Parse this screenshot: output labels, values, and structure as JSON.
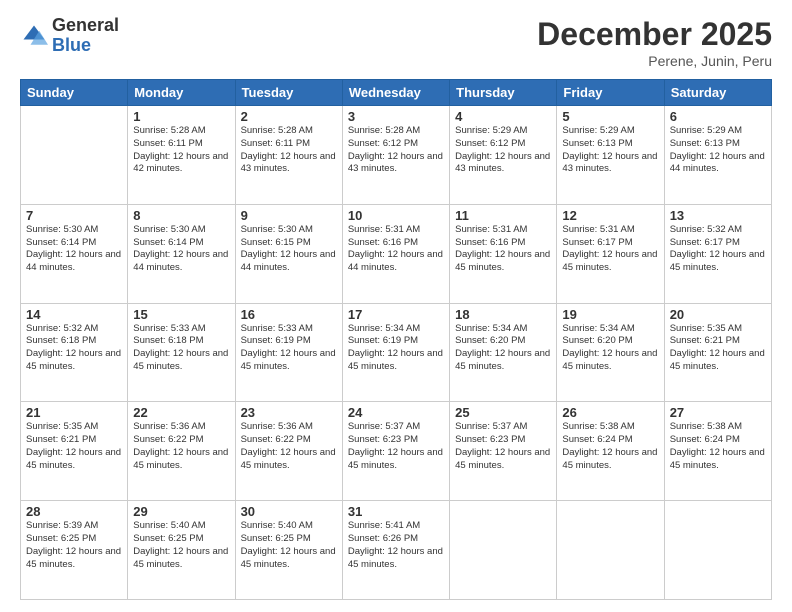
{
  "logo": {
    "general": "General",
    "blue": "Blue"
  },
  "title": "December 2025",
  "location": "Perene, Junin, Peru",
  "days_header": [
    "Sunday",
    "Monday",
    "Tuesday",
    "Wednesday",
    "Thursday",
    "Friday",
    "Saturday"
  ],
  "weeks": [
    [
      {
        "day": "",
        "info": ""
      },
      {
        "day": "1",
        "info": "Sunrise: 5:28 AM\nSunset: 6:11 PM\nDaylight: 12 hours and 42 minutes."
      },
      {
        "day": "2",
        "info": "Sunrise: 5:28 AM\nSunset: 6:11 PM\nDaylight: 12 hours and 43 minutes."
      },
      {
        "day": "3",
        "info": "Sunrise: 5:28 AM\nSunset: 6:12 PM\nDaylight: 12 hours and 43 minutes."
      },
      {
        "day": "4",
        "info": "Sunrise: 5:29 AM\nSunset: 6:12 PM\nDaylight: 12 hours and 43 minutes."
      },
      {
        "day": "5",
        "info": "Sunrise: 5:29 AM\nSunset: 6:13 PM\nDaylight: 12 hours and 43 minutes."
      },
      {
        "day": "6",
        "info": "Sunrise: 5:29 AM\nSunset: 6:13 PM\nDaylight: 12 hours and 44 minutes."
      }
    ],
    [
      {
        "day": "7",
        "info": "Sunrise: 5:30 AM\nSunset: 6:14 PM\nDaylight: 12 hours and 44 minutes."
      },
      {
        "day": "8",
        "info": "Sunrise: 5:30 AM\nSunset: 6:14 PM\nDaylight: 12 hours and 44 minutes."
      },
      {
        "day": "9",
        "info": "Sunrise: 5:30 AM\nSunset: 6:15 PM\nDaylight: 12 hours and 44 minutes."
      },
      {
        "day": "10",
        "info": "Sunrise: 5:31 AM\nSunset: 6:16 PM\nDaylight: 12 hours and 44 minutes."
      },
      {
        "day": "11",
        "info": "Sunrise: 5:31 AM\nSunset: 6:16 PM\nDaylight: 12 hours and 45 minutes."
      },
      {
        "day": "12",
        "info": "Sunrise: 5:31 AM\nSunset: 6:17 PM\nDaylight: 12 hours and 45 minutes."
      },
      {
        "day": "13",
        "info": "Sunrise: 5:32 AM\nSunset: 6:17 PM\nDaylight: 12 hours and 45 minutes."
      }
    ],
    [
      {
        "day": "14",
        "info": "Sunrise: 5:32 AM\nSunset: 6:18 PM\nDaylight: 12 hours and 45 minutes."
      },
      {
        "day": "15",
        "info": "Sunrise: 5:33 AM\nSunset: 6:18 PM\nDaylight: 12 hours and 45 minutes."
      },
      {
        "day": "16",
        "info": "Sunrise: 5:33 AM\nSunset: 6:19 PM\nDaylight: 12 hours and 45 minutes."
      },
      {
        "day": "17",
        "info": "Sunrise: 5:34 AM\nSunset: 6:19 PM\nDaylight: 12 hours and 45 minutes."
      },
      {
        "day": "18",
        "info": "Sunrise: 5:34 AM\nSunset: 6:20 PM\nDaylight: 12 hours and 45 minutes."
      },
      {
        "day": "19",
        "info": "Sunrise: 5:34 AM\nSunset: 6:20 PM\nDaylight: 12 hours and 45 minutes."
      },
      {
        "day": "20",
        "info": "Sunrise: 5:35 AM\nSunset: 6:21 PM\nDaylight: 12 hours and 45 minutes."
      }
    ],
    [
      {
        "day": "21",
        "info": "Sunrise: 5:35 AM\nSunset: 6:21 PM\nDaylight: 12 hours and 45 minutes."
      },
      {
        "day": "22",
        "info": "Sunrise: 5:36 AM\nSunset: 6:22 PM\nDaylight: 12 hours and 45 minutes."
      },
      {
        "day": "23",
        "info": "Sunrise: 5:36 AM\nSunset: 6:22 PM\nDaylight: 12 hours and 45 minutes."
      },
      {
        "day": "24",
        "info": "Sunrise: 5:37 AM\nSunset: 6:23 PM\nDaylight: 12 hours and 45 minutes."
      },
      {
        "day": "25",
        "info": "Sunrise: 5:37 AM\nSunset: 6:23 PM\nDaylight: 12 hours and 45 minutes."
      },
      {
        "day": "26",
        "info": "Sunrise: 5:38 AM\nSunset: 6:24 PM\nDaylight: 12 hours and 45 minutes."
      },
      {
        "day": "27",
        "info": "Sunrise: 5:38 AM\nSunset: 6:24 PM\nDaylight: 12 hours and 45 minutes."
      }
    ],
    [
      {
        "day": "28",
        "info": "Sunrise: 5:39 AM\nSunset: 6:25 PM\nDaylight: 12 hours and 45 minutes."
      },
      {
        "day": "29",
        "info": "Sunrise: 5:40 AM\nSunset: 6:25 PM\nDaylight: 12 hours and 45 minutes."
      },
      {
        "day": "30",
        "info": "Sunrise: 5:40 AM\nSunset: 6:25 PM\nDaylight: 12 hours and 45 minutes."
      },
      {
        "day": "31",
        "info": "Sunrise: 5:41 AM\nSunset: 6:26 PM\nDaylight: 12 hours and 45 minutes."
      },
      {
        "day": "",
        "info": ""
      },
      {
        "day": "",
        "info": ""
      },
      {
        "day": "",
        "info": ""
      }
    ]
  ]
}
